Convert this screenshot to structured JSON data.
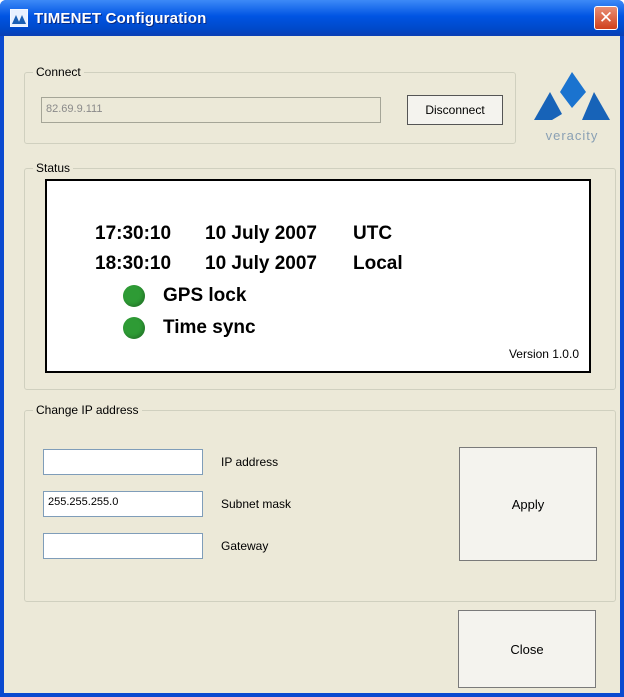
{
  "window": {
    "title": "TIMENET Configuration",
    "close_glyph": "✕"
  },
  "connect": {
    "label": "Connect",
    "ip_value": "82.69.9.111",
    "disconnect_label": "Disconnect"
  },
  "logo": {
    "text": "veracity"
  },
  "status": {
    "label": "Status",
    "utc_time": "17:30:10",
    "utc_date": "10 July 2007",
    "utc_zone": "UTC",
    "local_time": "18:30:10",
    "local_date": "10 July 2007",
    "local_zone": "Local",
    "gps_label": "GPS lock",
    "sync_label": "Time sync",
    "indicator_color": "#2e9b35",
    "version": "Version 1.0.0"
  },
  "change_ip": {
    "label": "Change IP address",
    "ip_label": "IP address",
    "ip_value": "",
    "subnet_label": "Subnet mask",
    "subnet_value": "255.255.255.0",
    "gateway_label": "Gateway",
    "gateway_value": "",
    "apply_label": "Apply"
  },
  "close_label": "Close"
}
